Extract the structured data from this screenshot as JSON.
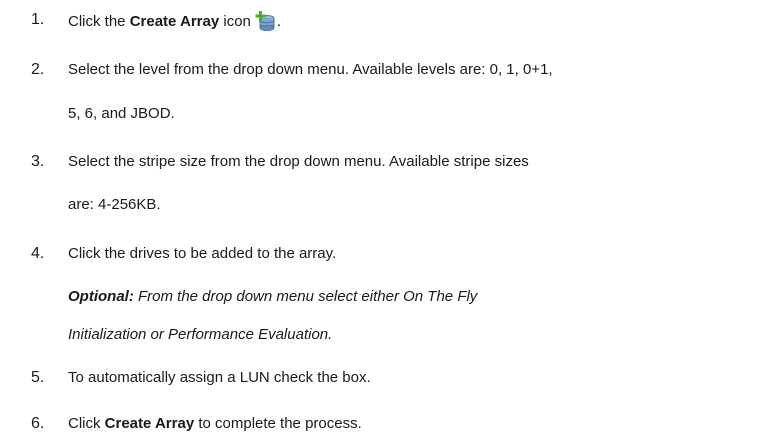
{
  "steps": [
    {
      "number": "1.",
      "before_bold": "Click the ",
      "bold": "Create Array",
      "after_bold": " icon",
      "after_icon": ".",
      "icon": "create-array-icon"
    },
    {
      "number": "2.",
      "line1": "Select the level from the drop down menu. Available levels are: 0, 1, 0+1,",
      "line2": "5, 6, and JBOD."
    },
    {
      "number": "3.",
      "line1": "Select the stripe size from the drop down menu. Available stripe sizes",
      "line2": "are: 4-256KB."
    },
    {
      "number": "4.",
      "line1": "Click the drives to be added to the array.",
      "optional_label": "Optional:",
      "optional_line1": " From the drop down menu select either On The Fly",
      "optional_line2": "Initialization or Performance Evaluation."
    },
    {
      "number": "5.",
      "line1": "To automatically assign a LUN check the box."
    },
    {
      "number": "6.",
      "before_bold": "Click ",
      "bold": "Create Array",
      "after_bold": " to complete the process."
    }
  ],
  "colors": {
    "text": "#1a1a1a",
    "icon_plus": "#4caf2a",
    "icon_db": "#6a8fb5"
  }
}
